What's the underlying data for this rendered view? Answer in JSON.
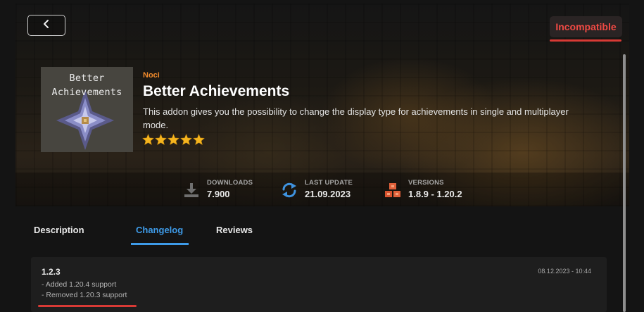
{
  "header": {
    "back_icon": "chevron-left-icon",
    "status_badge": "Incompatible",
    "status_color": "#ef4a44"
  },
  "addon": {
    "thumbnail_title": "Better\nAchievements",
    "author": "Noci",
    "title": "Better Achievements",
    "description": "This addon gives you the possibility to change the display type for achievements in single and multiplayer mode.",
    "rating": 5,
    "rating_max": 5,
    "accent_color": "#f08a2c"
  },
  "stats": {
    "downloads": {
      "label": "DOWNLOADS",
      "value": "7.900",
      "icon": "download-icon"
    },
    "last_update": {
      "label": "LAST UPDATE",
      "value": "21.09.2023",
      "icon": "refresh-icon"
    },
    "versions": {
      "label": "VERSIONS",
      "value": "1.8.9 - 1.20.2",
      "icon": "blocks-icon"
    }
  },
  "tabs": [
    {
      "label": "Description",
      "active": false
    },
    {
      "label": "Changelog",
      "active": true
    },
    {
      "label": "Reviews",
      "active": false
    }
  ],
  "changelog": [
    {
      "version": "1.2.3",
      "date": "08.12.2023 - 10:44",
      "changes": [
        "- Added 1.20.4 support",
        "- Removed 1.20.3 support"
      ]
    }
  ]
}
